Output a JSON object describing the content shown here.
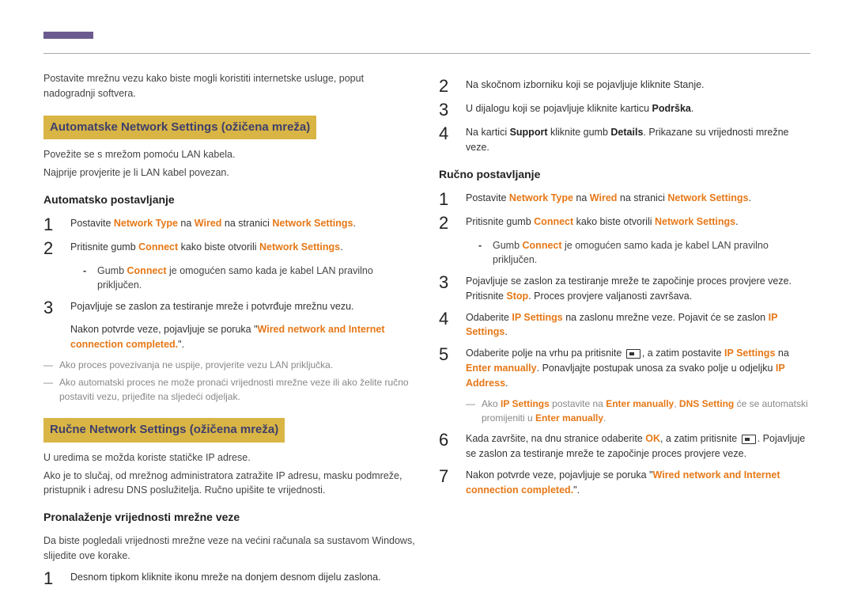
{
  "intro": "Postavite mrežnu vezu kako biste mogli koristiti internetske usluge, poput nadogradnji softvera.",
  "sec1": {
    "title": "Automatske Network Settings  (ožičena mreža)",
    "p1": "Povežite se s mrežom pomoću LAN kabela.",
    "p2": "Najprije provjerite je li LAN kabel povezan.",
    "sub": "Automatsko postavljanje",
    "s1a": "Postavite ",
    "s1b": "Network Type",
    "s1c": " na ",
    "s1d": "Wired",
    "s1e": " na stranici ",
    "s1f": "Network Settings",
    "s1g": ".",
    "s2a": "Pritisnite gumb ",
    "s2b": "Connect",
    "s2c": " kako biste otvorili ",
    "s2d": "Network Settings",
    "s2e": ".",
    "d1a": "Gumb ",
    "d1b": "Connect",
    "d1c": " je omogućen samo kada je kabel LAN pravilno priključen.",
    "s3": "Pojavljuje se zaslon za testiranje mreže i potvrđuje mrežnu vezu.",
    "s3b1": "Nakon potvrde veze, pojavljuje se poruka \"",
    "s3b2": "Wired network and Internet connection completed.",
    "s3b3": "\".",
    "n1": "Ako proces povezivanja ne uspije, provjerite vezu LAN priključka.",
    "n2": "Ako automatski proces ne može pronaći vrijednosti mrežne veze ili ako želite ručno postaviti vezu, prijeđite na sljedeći odjeljak."
  },
  "sec2": {
    "title": "Ručne Network Settings  (ožičena mreža)",
    "p1": "U uredima se možda koriste statičke IP adrese.",
    "p2": "Ako je to slučaj, od mrežnog administratora zatražite IP adresu, masku podmreže, pristupnik i adresu DNS poslužitelja. Ručno upišite te vrijednosti.",
    "sub": "Pronalaženje vrijednosti mrežne veze",
    "lead": "Da biste pogledali vrijednosti mrežne veze na većini računala sa sustavom Windows, slijedite ove korake.",
    "s1": "Desnom tipkom kliknite ikonu mreže na donjem desnom dijelu zaslona."
  },
  "right": {
    "s2": "Na skočnom izborniku koji se pojavljuje kliknite Stanje.",
    "s3a": "U dijalogu koji se pojavljuje kliknite karticu ",
    "s3b": "Podrška",
    "s3c": ".",
    "s4a": "Na kartici ",
    "s4b": "Support",
    "s4c": " kliknite gumb ",
    "s4d": "Details",
    "s4e": ". Prikazane su vrijednosti mrežne veze.",
    "sub": "Ručno postavljanje",
    "r1a": "Postavite ",
    "r1b": "Network Type",
    "r1c": " na ",
    "r1d": "Wired",
    "r1e": " na stranici ",
    "r1f": "Network Settings",
    "r1g": ".",
    "r2a": "Pritisnite gumb ",
    "r2b": "Connect",
    "r2c": " kako biste otvorili ",
    "r2d": "Network Settings",
    "r2e": ".",
    "rd1a": "Gumb ",
    "rd1b": "Connect",
    "rd1c": " je omogućen samo kada je kabel LAN pravilno priključen.",
    "r3a": "Pojavljuje se zaslon za testiranje mreže te započinje proces provjere veze. Pritisnite ",
    "r3b": "Stop",
    "r3c": ". Proces provjere valjanosti završava.",
    "r4a": "Odaberite ",
    "r4b": "IP Settings",
    "r4c": " na zaslonu mrežne veze. Pojavit će se zaslon ",
    "r4d": "IP Settings",
    "r4e": ".",
    "r5a": "Odaberite polje na vrhu pa pritisnite ",
    "r5b": ", a zatim postavite ",
    "r5c": "IP Settings",
    "r5d": " na ",
    "r5e": "Enter manually",
    "r5f": ". Ponavljajte postupak unosa za svako polje u odjeljku ",
    "r5g": "IP Address",
    "r5h": ".",
    "rn1a": "Ako ",
    "rn1b": "IP Settings",
    "rn1c": " postavite na ",
    "rn1d": "Enter manually",
    "rn1e": ", ",
    "rn1f": "DNS Setting",
    "rn1g": " će se automatski promijeniti u ",
    "rn1h": "Enter manually",
    "rn1i": ".",
    "r6a": "Kada završite, na dnu stranice odaberite ",
    "r6b": "OK",
    "r6c": ", a zatim pritisnite ",
    "r6d": ". Pojavljuje se zaslon za testiranje mreže te započinje proces provjere veze.",
    "r7a": "Nakon potvrde veze, pojavljuje se poruka \"",
    "r7b": "Wired network and Internet connection completed.",
    "r7c": "\"."
  },
  "nums": {
    "n1": "1",
    "n2": "2",
    "n3": "3",
    "n4": "4",
    "n5": "5",
    "n6": "6",
    "n7": "7"
  }
}
